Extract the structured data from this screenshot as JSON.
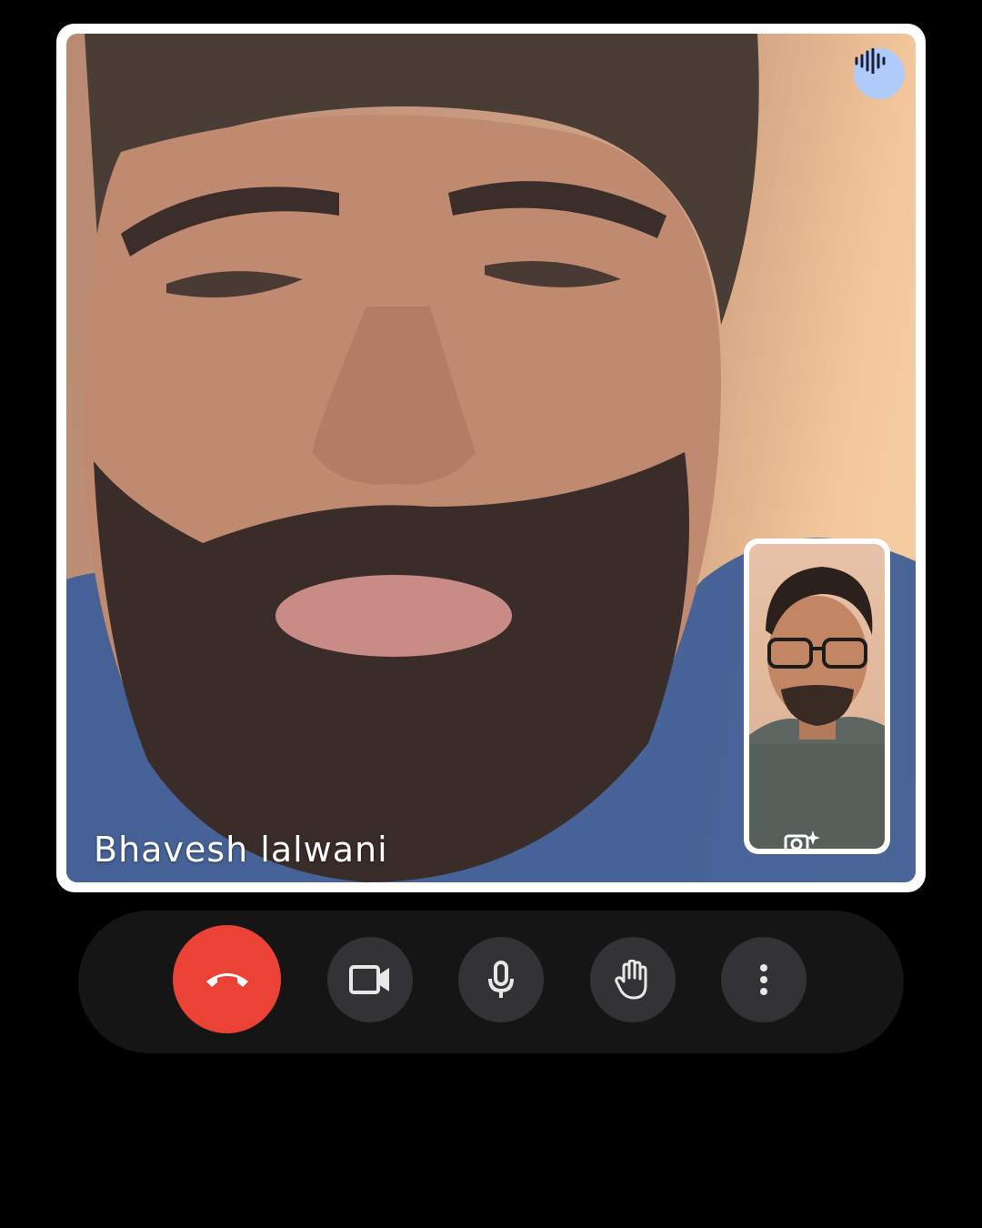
{
  "call": {
    "participant_name": "Bhavesh lalwani",
    "speaking": true
  },
  "controls": [
    {
      "id": "end-call",
      "icon": "phone-hangup-icon",
      "color": "#ea4335"
    },
    {
      "id": "camera",
      "icon": "video-camera-icon",
      "color": "#333335"
    },
    {
      "id": "microphone",
      "icon": "microphone-icon",
      "color": "#333335"
    },
    {
      "id": "raise-hand",
      "icon": "hand-icon",
      "color": "#333335"
    },
    {
      "id": "more-options",
      "icon": "more-vertical-icon",
      "color": "#333335"
    }
  ],
  "colors": {
    "background": "#000000",
    "frame": "#ffffff",
    "control_bar": "#151515",
    "end_call": "#ea4335",
    "speaking_badge": "#aecbfa"
  }
}
